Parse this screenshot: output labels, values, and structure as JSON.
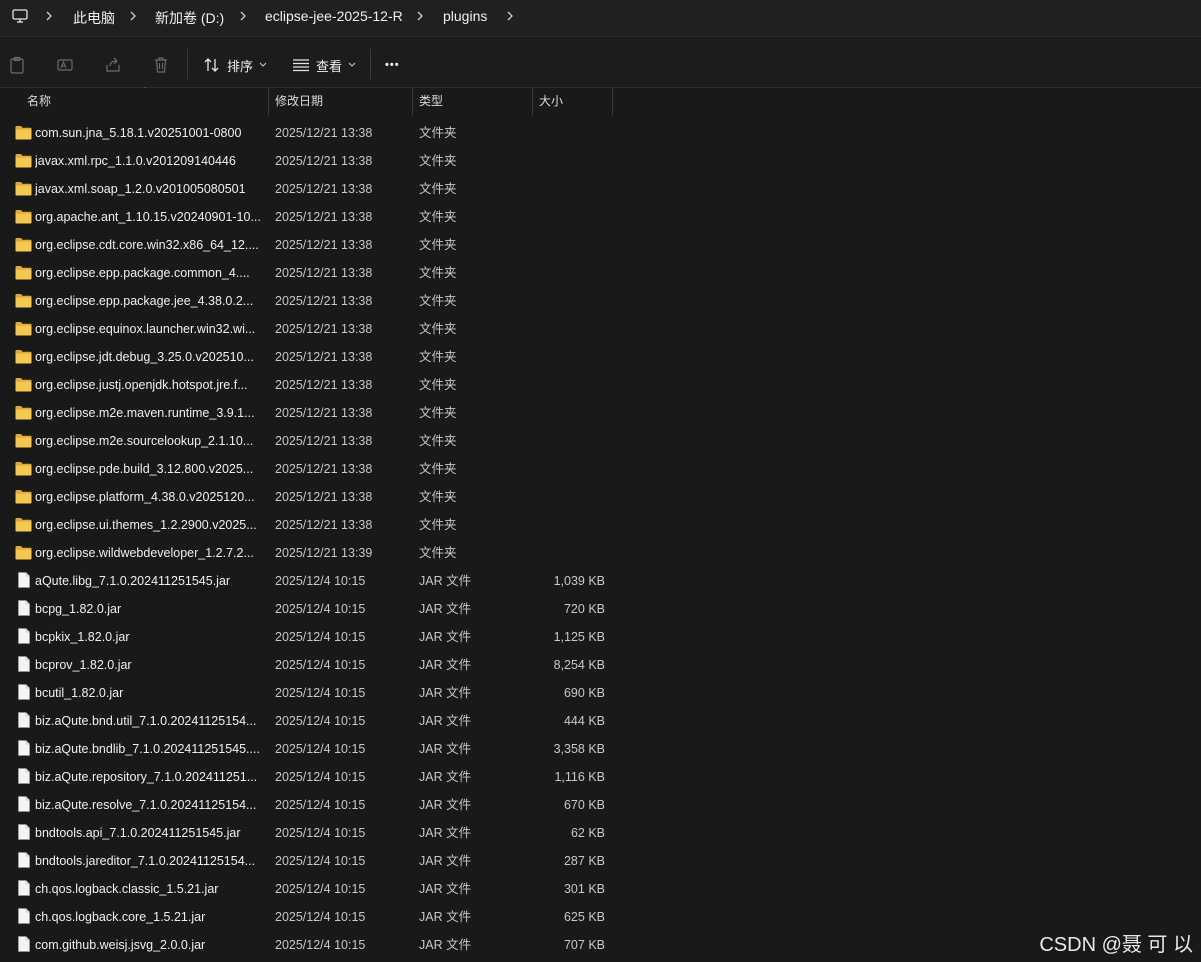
{
  "breadcrumb": {
    "items": [
      "此电脑",
      "新加卷 (D:)",
      "eclipse-jee-2025-12-R",
      "plugins"
    ]
  },
  "toolbar": {
    "sort_label": "排序",
    "view_label": "查看",
    "more_label": "•••"
  },
  "columns": {
    "name": "名称",
    "date": "修改日期",
    "type": "类型",
    "size": "大小"
  },
  "files": [
    {
      "kind": "folder",
      "name": "com.sun.jna_5.18.1.v20251001-0800",
      "date": "2025/12/21 13:38",
      "type": "文件夹",
      "size": ""
    },
    {
      "kind": "folder",
      "name": "javax.xml.rpc_1.1.0.v201209140446",
      "date": "2025/12/21 13:38",
      "type": "文件夹",
      "size": ""
    },
    {
      "kind": "folder",
      "name": "javax.xml.soap_1.2.0.v201005080501",
      "date": "2025/12/21 13:38",
      "type": "文件夹",
      "size": ""
    },
    {
      "kind": "folder",
      "name": "org.apache.ant_1.10.15.v20240901-10...",
      "date": "2025/12/21 13:38",
      "type": "文件夹",
      "size": ""
    },
    {
      "kind": "folder",
      "name": "org.eclipse.cdt.core.win32.x86_64_12....",
      "date": "2025/12/21 13:38",
      "type": "文件夹",
      "size": ""
    },
    {
      "kind": "folder",
      "name": "org.eclipse.epp.package.common_4....",
      "date": "2025/12/21 13:38",
      "type": "文件夹",
      "size": ""
    },
    {
      "kind": "folder",
      "name": "org.eclipse.epp.package.jee_4.38.0.2...",
      "date": "2025/12/21 13:38",
      "type": "文件夹",
      "size": ""
    },
    {
      "kind": "folder",
      "name": "org.eclipse.equinox.launcher.win32.wi...",
      "date": "2025/12/21 13:38",
      "type": "文件夹",
      "size": ""
    },
    {
      "kind": "folder",
      "name": "org.eclipse.jdt.debug_3.25.0.v202510...",
      "date": "2025/12/21 13:38",
      "type": "文件夹",
      "size": ""
    },
    {
      "kind": "folder",
      "name": "org.eclipse.justj.openjdk.hotspot.jre.f...",
      "date": "2025/12/21 13:38",
      "type": "文件夹",
      "size": ""
    },
    {
      "kind": "folder",
      "name": "org.eclipse.m2e.maven.runtime_3.9.1...",
      "date": "2025/12/21 13:38",
      "type": "文件夹",
      "size": ""
    },
    {
      "kind": "folder",
      "name": "org.eclipse.m2e.sourcelookup_2.1.10...",
      "date": "2025/12/21 13:38",
      "type": "文件夹",
      "size": ""
    },
    {
      "kind": "folder",
      "name": "org.eclipse.pde.build_3.12.800.v2025...",
      "date": "2025/12/21 13:38",
      "type": "文件夹",
      "size": ""
    },
    {
      "kind": "folder",
      "name": "org.eclipse.platform_4.38.0.v2025120...",
      "date": "2025/12/21 13:38",
      "type": "文件夹",
      "size": ""
    },
    {
      "kind": "folder",
      "name": "org.eclipse.ui.themes_1.2.2900.v2025...",
      "date": "2025/12/21 13:38",
      "type": "文件夹",
      "size": ""
    },
    {
      "kind": "folder",
      "name": "org.eclipse.wildwebdeveloper_1.2.7.2...",
      "date": "2025/12/21 13:39",
      "type": "文件夹",
      "size": ""
    },
    {
      "kind": "file",
      "name": "aQute.libg_7.1.0.202411251545.jar",
      "date": "2025/12/4 10:15",
      "type": "JAR 文件",
      "size": "1,039 KB"
    },
    {
      "kind": "file",
      "name": "bcpg_1.82.0.jar",
      "date": "2025/12/4 10:15",
      "type": "JAR 文件",
      "size": "720 KB"
    },
    {
      "kind": "file",
      "name": "bcpkix_1.82.0.jar",
      "date": "2025/12/4 10:15",
      "type": "JAR 文件",
      "size": "1,125 KB"
    },
    {
      "kind": "file",
      "name": "bcprov_1.82.0.jar",
      "date": "2025/12/4 10:15",
      "type": "JAR 文件",
      "size": "8,254 KB"
    },
    {
      "kind": "file",
      "name": "bcutil_1.82.0.jar",
      "date": "2025/12/4 10:15",
      "type": "JAR 文件",
      "size": "690 KB"
    },
    {
      "kind": "file",
      "name": "biz.aQute.bnd.util_7.1.0.20241125154...",
      "date": "2025/12/4 10:15",
      "type": "JAR 文件",
      "size": "444 KB"
    },
    {
      "kind": "file",
      "name": "biz.aQute.bndlib_7.1.0.202411251545....",
      "date": "2025/12/4 10:15",
      "type": "JAR 文件",
      "size": "3,358 KB"
    },
    {
      "kind": "file",
      "name": "biz.aQute.repository_7.1.0.202411251...",
      "date": "2025/12/4 10:15",
      "type": "JAR 文件",
      "size": "1,116 KB"
    },
    {
      "kind": "file",
      "name": "biz.aQute.resolve_7.1.0.20241125154...",
      "date": "2025/12/4 10:15",
      "type": "JAR 文件",
      "size": "670 KB"
    },
    {
      "kind": "file",
      "name": "bndtools.api_7.1.0.202411251545.jar",
      "date": "2025/12/4 10:15",
      "type": "JAR 文件",
      "size": "62 KB"
    },
    {
      "kind": "file",
      "name": "bndtools.jareditor_7.1.0.20241125154...",
      "date": "2025/12/4 10:15",
      "type": "JAR 文件",
      "size": "287 KB"
    },
    {
      "kind": "file",
      "name": "ch.qos.logback.classic_1.5.21.jar",
      "date": "2025/12/4 10:15",
      "type": "JAR 文件",
      "size": "301 KB"
    },
    {
      "kind": "file",
      "name": "ch.qos.logback.core_1.5.21.jar",
      "date": "2025/12/4 10:15",
      "type": "JAR 文件",
      "size": "625 KB"
    },
    {
      "kind": "file",
      "name": "com.github.weisj.jsvg_2.0.0.jar",
      "date": "2025/12/4 10:15",
      "type": "JAR 文件",
      "size": "707 KB"
    }
  ],
  "watermark": "CSDN @聂 可 以",
  "colors": {
    "background": "#191919",
    "folder": "#f2c55c",
    "text": "#f0f0f0",
    "muted": "#c8c8c8"
  }
}
